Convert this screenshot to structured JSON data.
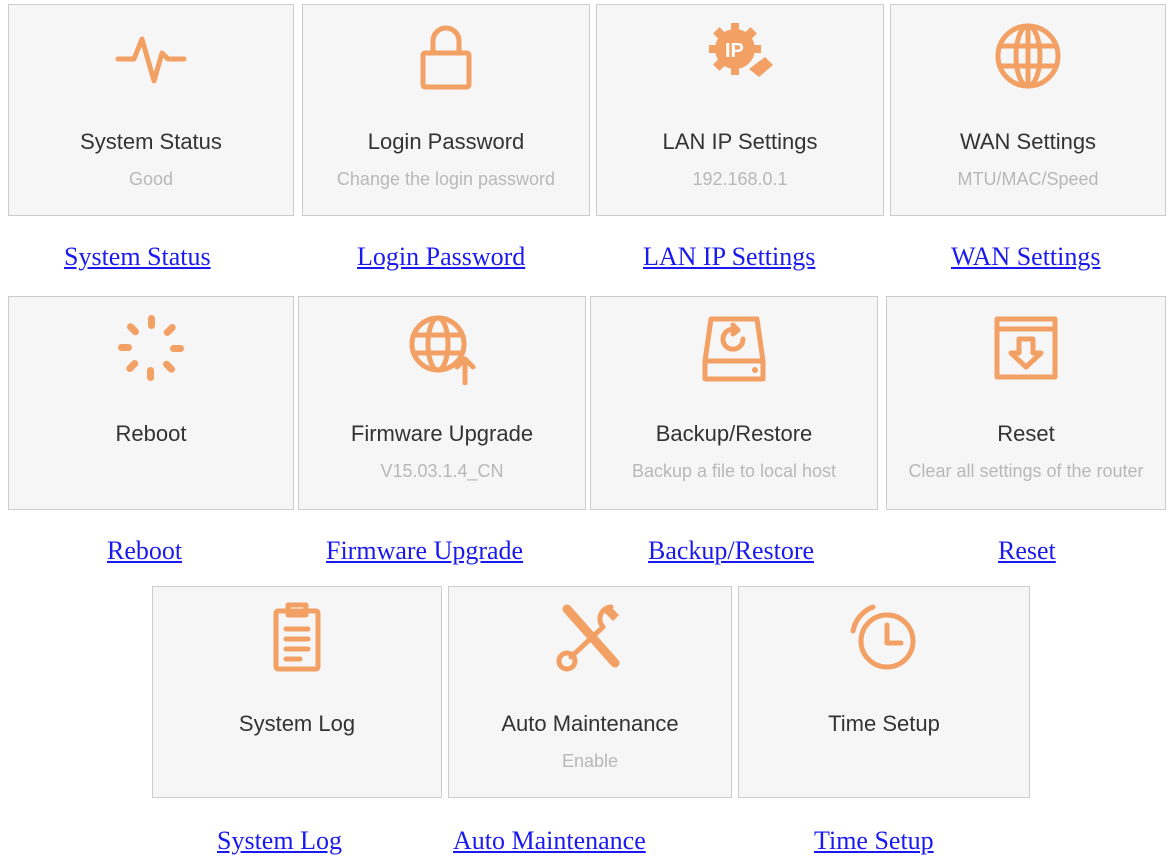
{
  "accent_color": "#f2a063",
  "link_color": "#1a1aee",
  "tiles": [
    {
      "title": "System Status",
      "subtitle": "Good",
      "icon": "pulse-icon",
      "link": "System Status"
    },
    {
      "title": "Login Password",
      "subtitle": "Change the login password",
      "icon": "lock-icon",
      "link": "Login Password"
    },
    {
      "title": "LAN IP Settings",
      "subtitle": "192.168.0.1",
      "icon": "ip-gear-icon",
      "link": "LAN IP Settings"
    },
    {
      "title": "WAN Settings",
      "subtitle": "MTU/MAC/Speed",
      "icon": "globe-icon",
      "link": "WAN Settings"
    },
    {
      "title": "Reboot",
      "subtitle": "",
      "icon": "spinner-icon",
      "link": "Reboot"
    },
    {
      "title": "Firmware Upgrade",
      "subtitle": "V15.03.1.4_CN",
      "icon": "globe-upload-icon",
      "link": "Firmware Upgrade"
    },
    {
      "title": "Backup/Restore",
      "subtitle": "Backup a file to local host",
      "icon": "disk-restore-icon",
      "link": "Backup/Restore"
    },
    {
      "title": "Reset",
      "subtitle": "Clear all settings of the router",
      "icon": "box-reset-icon",
      "link": "Reset"
    },
    {
      "title": "System Log",
      "subtitle": "",
      "icon": "clipboard-icon",
      "link": "System Log"
    },
    {
      "title": "Auto Maintenance",
      "subtitle": "Enable",
      "icon": "tools-icon",
      "link": "Auto Maintenance"
    },
    {
      "title": "Time Setup",
      "subtitle": "",
      "icon": "clock-icon",
      "link": "Time Setup"
    }
  ]
}
